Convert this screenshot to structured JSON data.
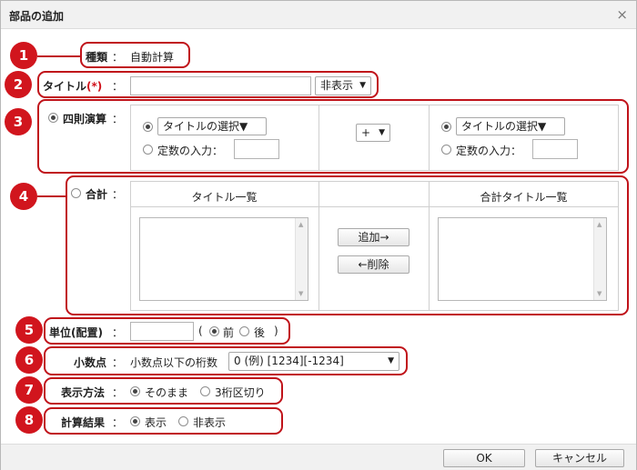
{
  "dialog": {
    "title": "部品の追加",
    "close_glyph": "×",
    "ok_label": "OK",
    "cancel_label": "キャンセル"
  },
  "badges": [
    "1",
    "2",
    "3",
    "4",
    "5",
    "6",
    "7",
    "8"
  ],
  "type_row": {
    "label": "種類",
    "colon": "：",
    "value": "自動計算"
  },
  "title_row": {
    "label": "タイトル",
    "required": "(*)",
    "colon": "：",
    "value": "",
    "visibility_select": "非表示",
    "arrow": "▼"
  },
  "arithmetic": {
    "label": "四則演算",
    "colon": "：",
    "selected": true,
    "left": {
      "title_select": "タイトルの選択▼",
      "select_arrow": "▼",
      "const_label": "定数の入力：",
      "mode": "title"
    },
    "operator": "+",
    "operator_arrow": "▼",
    "right": {
      "title_select": "タイトルの選択▼",
      "select_arrow": "▼",
      "const_label": "定数の入力：",
      "mode": "title"
    }
  },
  "sum": {
    "label": "合計",
    "colon": "：",
    "selected": false,
    "list_header": "タイトル一覧",
    "sum_list_header": "合計タイトル一覧",
    "add_button": "追加→",
    "remove_button": "←削除"
  },
  "unit": {
    "label": "単位(配置)",
    "colon": "：",
    "value": "",
    "open_paren": "(",
    "before_label": "前",
    "after_label": "後",
    "close_paren": ")",
    "selected": "before"
  },
  "decimal": {
    "label": "小数点",
    "colon": "：",
    "sublabel": "小数点以下の桁数",
    "select_value": "0 (例) [1234][-1234]",
    "arrow": "▼"
  },
  "display_method": {
    "label": "表示方法",
    "colon": "：",
    "option_asis": "そのまま",
    "option_comma": "3桁区切り",
    "selected": "asis"
  },
  "calc_result": {
    "label": "計算結果",
    "colon": "：",
    "option_show": "表示",
    "option_hide": "非表示",
    "selected": "show"
  },
  "colors": {
    "accent": "#d1151d",
    "border": "#c0131a"
  },
  "icons": {
    "close": "close-icon",
    "scroll_up": "scroll-up-icon",
    "scroll_down": "scroll-down-icon",
    "dropdown": "chevron-down-icon"
  }
}
